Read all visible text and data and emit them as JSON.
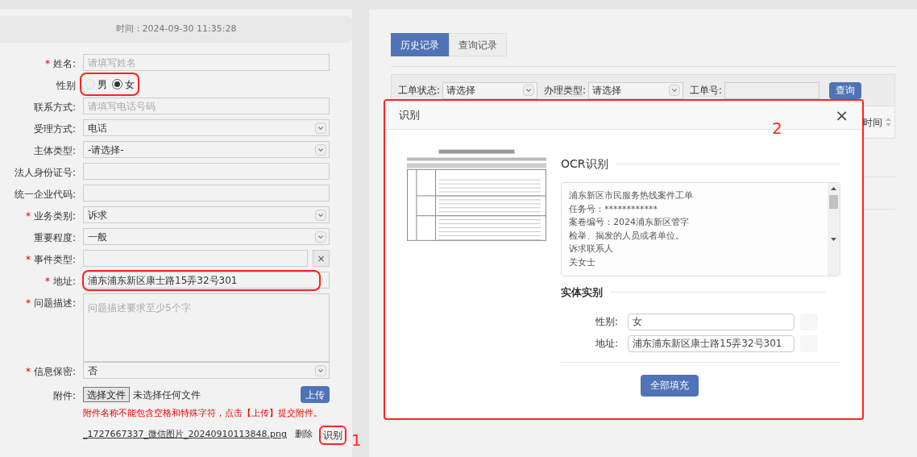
{
  "form": {
    "time": "时间：2024-09-30 11:35:28",
    "required_mark": "*",
    "fields": [
      {
        "kind": "text",
        "label": "姓名:",
        "required": true,
        "placeholder": "请填写姓名"
      },
      {
        "kind": "radio",
        "label": "性别",
        "required": false,
        "highlighted": true,
        "options": [
          {
            "label": "男",
            "selected": false,
            "disabled": true
          },
          {
            "label": "女",
            "selected": true,
            "disabled": false
          }
        ]
      },
      {
        "kind": "text",
        "label": "联系方式:",
        "required": false,
        "placeholder": "请填写电话号码"
      },
      {
        "kind": "select",
        "label": "受理方式:",
        "required": false,
        "value": "电话"
      },
      {
        "kind": "select",
        "label": "主体类型:",
        "required": false,
        "value": "-请选择-"
      },
      {
        "kind": "text",
        "label": "法人身份证号:",
        "required": false
      },
      {
        "kind": "text",
        "label": "统一企业代码:",
        "required": false
      },
      {
        "kind": "select",
        "label": "业务类别:",
        "required": true,
        "value": "诉求"
      },
      {
        "kind": "select",
        "label": "重要程度:",
        "required": false,
        "value": "一般"
      },
      {
        "kind": "picker",
        "label": "事件类型:",
        "required": true,
        "clear": "×"
      },
      {
        "kind": "text",
        "label": "地址:",
        "required": true,
        "value": "浦东浦东新区康士路15弄32号301",
        "highlighted": true
      },
      {
        "kind": "textarea",
        "label": "问题描述:",
        "required": true,
        "placeholder": "问题描述要求至少5个字"
      },
      {
        "kind": "select",
        "label": "信息保密:",
        "required": true,
        "value": "否"
      }
    ],
    "attachment": {
      "label": "附件:",
      "choose": "选择文件",
      "status": "未选择任何文件",
      "upload": "上传",
      "note": "附件名称不能包含空格和特殊字符，点击【上传】提交附件。",
      "file": "_1727667337_微信图片_20240910113848.png",
      "delete": "删除",
      "recognize": "识别",
      "recognize_highlighted": true
    }
  },
  "history": {
    "tabs": [
      {
        "label": "历史记录",
        "selected": true
      },
      {
        "label": "查询记录",
        "selected": false
      }
    ],
    "filters": [
      {
        "kind": "select",
        "label": "工单状态:",
        "value": "请选择"
      },
      {
        "kind": "select",
        "label": "办理类型:",
        "value": "请选择"
      },
      {
        "kind": "text",
        "label": "工单号:"
      }
    ],
    "search": "查询",
    "column": "时间"
  },
  "dialog": {
    "title": "识别",
    "close": "×",
    "highlighted": true,
    "ocr_title": "OCR识别",
    "ocr_lines": [
      "浦东新区市民服务热线案件工单",
      "任务号：************",
      "案卷编号：2024浦东新区管字",
      "检举、揭发的人员或者单位。",
      "诉求联系人",
      "关女士"
    ],
    "entity_title": "实体实别",
    "entities": [
      {
        "label": "性别:",
        "value": "女"
      },
      {
        "label": "地址:",
        "value": "浦东浦东新区康士路15弄32号301"
      }
    ],
    "fill_all": "全部填充"
  },
  "annotations": [
    "1",
    "2"
  ]
}
